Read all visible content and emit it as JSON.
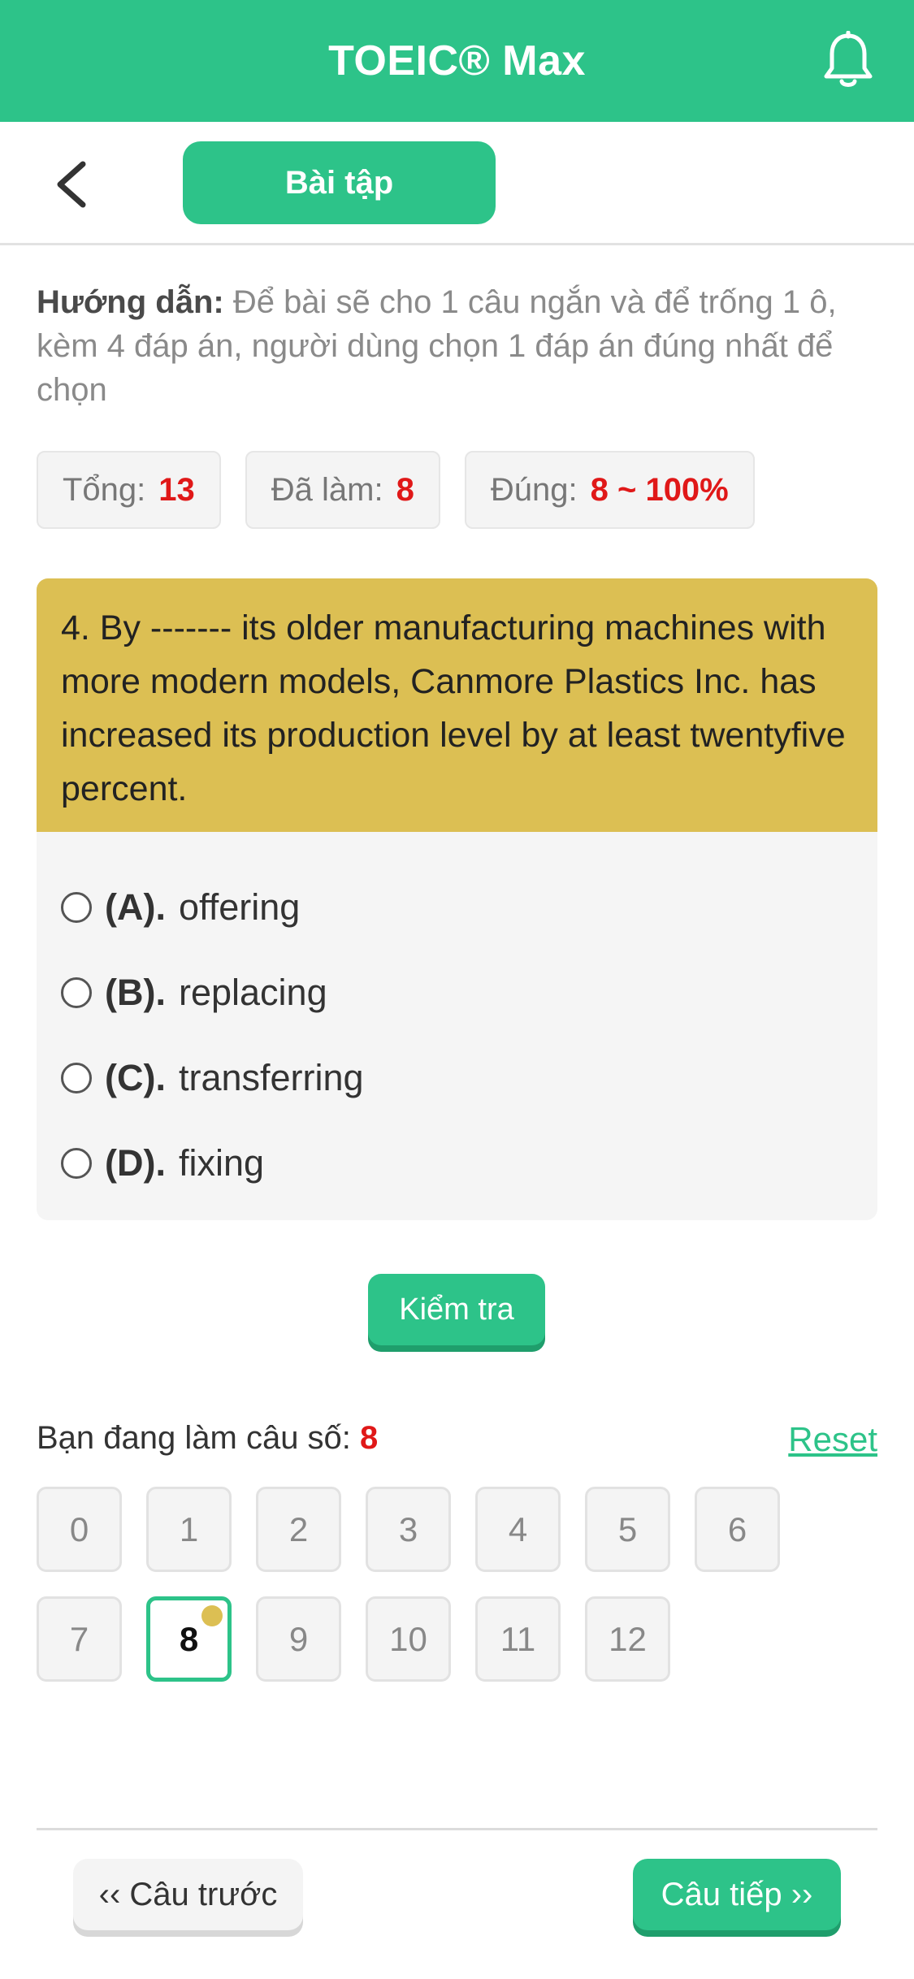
{
  "header": {
    "title": "TOEIC® Max",
    "notification_icon": "bell-icon"
  },
  "subbar": {
    "back_icon": "chevron-left-icon",
    "tab_label": "Bài tập"
  },
  "instruction": {
    "label": "Hướng dẫn:",
    "text": " Để bài sẽ cho 1 câu ngắn và để trống 1 ô, kèm 4 đáp án, người dùng chọn 1 đáp án đúng nhất để chọn"
  },
  "stats": [
    {
      "label": "Tổng:",
      "value": "13"
    },
    {
      "label": "Đã làm:",
      "value": "8"
    },
    {
      "label": "Đúng:",
      "value": "8 ~ 100%"
    }
  ],
  "question": {
    "text": "4. By ------- its older manufacturing machines with more modern models, Canmore Plastics Inc. has increased its production level by at least twentyfive percent.",
    "options": [
      {
        "key": "(A).",
        "text": "offering"
      },
      {
        "key": "(B).",
        "text": "replacing"
      },
      {
        "key": "(C).",
        "text": "transferring"
      },
      {
        "key": "(D).",
        "text": "fixing"
      }
    ]
  },
  "check_button": "Kiểm tra",
  "progress": {
    "label": "Bạn đang làm câu số:",
    "current": "8",
    "reset": "Reset"
  },
  "question_numbers": [
    "0",
    "1",
    "2",
    "3",
    "4",
    "5",
    "6",
    "7",
    "8",
    "9",
    "10",
    "11",
    "12"
  ],
  "active_question": "8",
  "navigation": {
    "prev": "‹‹ Câu trước",
    "next": "Câu tiếp ››"
  },
  "colors": {
    "primary": "#2dc389",
    "question_bg": "#dcbf53",
    "highlight": "#e01818"
  }
}
